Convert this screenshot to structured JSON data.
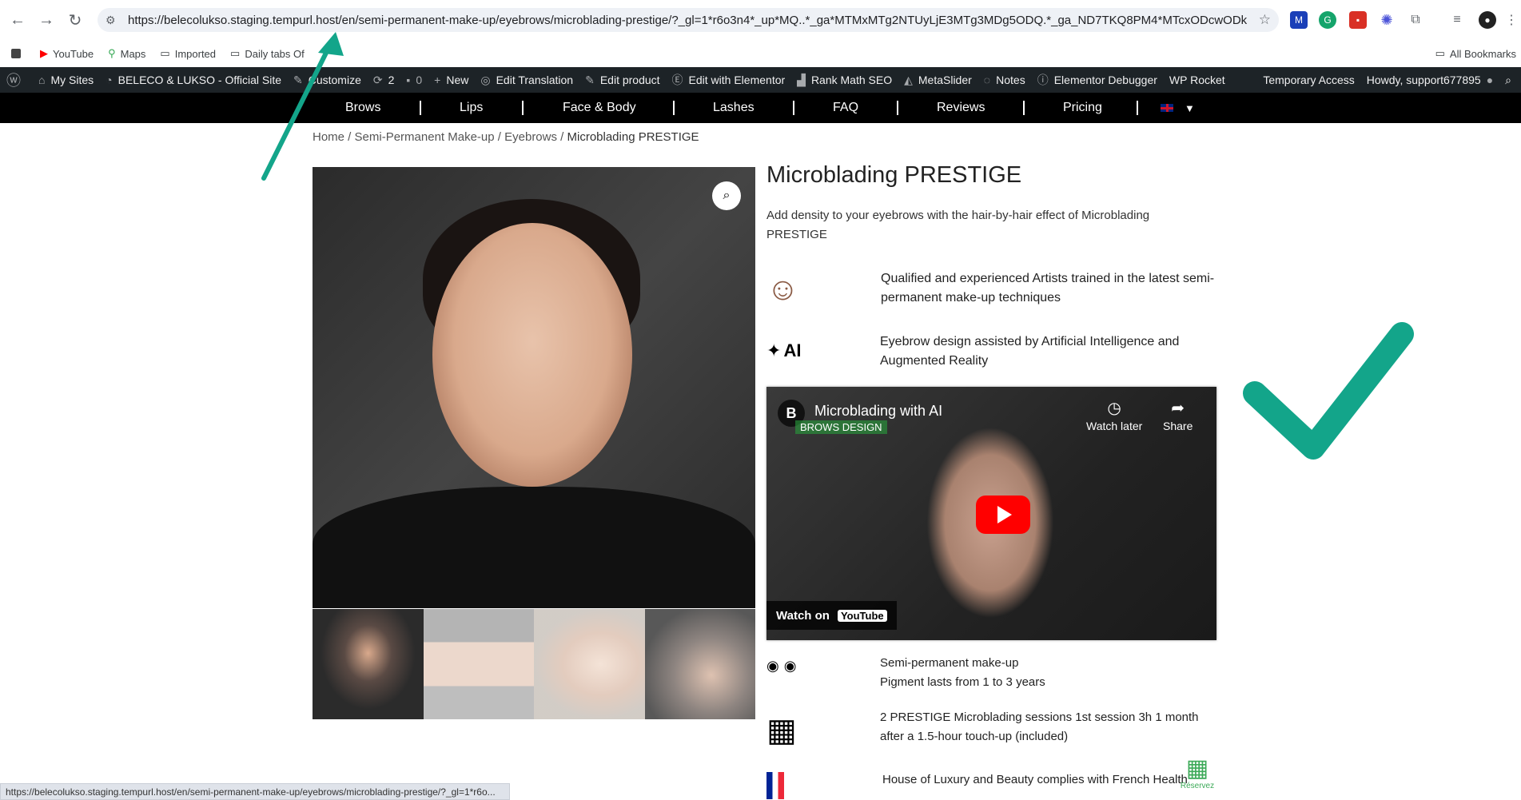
{
  "browser": {
    "url": "https://belecolukso.staging.tempurl.host/en/semi-permanent-make-up/eyebrows/microblading-prestige/?_gl=1*r6o3n4*_up*MQ..*_ga*MTMxMTg2NTUyLjE3MTg3MDg5ODQ.*_ga_ND7TKQ8PM4*MTcxODcwODk4My4xLjAuMTc...",
    "status_url": "https://belecolukso.staging.tempurl.host/en/semi-permanent-make-up/eyebrows/microblading-prestige/?_gl=1*r6o...",
    "bookmarks": [
      "YouTube",
      "Maps",
      "Imported",
      "Daily tabs Of"
    ],
    "all_bookmarks": "All Bookmarks"
  },
  "adminbar": {
    "left": [
      "My Sites",
      "BELECO & LUKSO - Official Site",
      "Customize",
      "2",
      "0",
      "New",
      "Edit Translation",
      "Edit product",
      "Edit with Elementor",
      "Rank Math SEO",
      "MetaSlider",
      "Notes",
      "Elementor Debugger",
      "WP Rocket"
    ],
    "temporary_access": "Temporary Access",
    "howdy": "Howdy, support677895"
  },
  "mainnav": [
    "Brows",
    "Lips",
    "Face & Body",
    "Lashes",
    "FAQ",
    "Reviews",
    "Pricing"
  ],
  "breadcrumb": {
    "home": "Home",
    "cat": "Semi-Permanent Make-up",
    "sub": "Eyebrows",
    "current": "Microblading PRESTIGE",
    "sep": " / "
  },
  "product": {
    "title": "Microblading PRESTIGE",
    "description": "Add density to your eyebrows with the hair-by-hair effect of Microblading PRESTIGE",
    "features": [
      {
        "text": "Qualified and experienced Artists trained in the latest semi-permanent make-up techniques"
      },
      {
        "text": "Eyebrow design assisted by Artificial Intelligence and Augmented Reality",
        "icon_label": "AI"
      },
      {
        "text": "Semi-permanent make-up",
        "text2": "Pigment lasts from 1 to 3 years"
      },
      {
        "text": "2 PRESTIGE Microblading sessions 1st session 3h   1 month after a 1.5-hour touch-up (included)"
      },
      {
        "text": "House of Luxury and Beauty complies with French",
        "tail": "Health"
      }
    ]
  },
  "video": {
    "title": "Microblading with AI",
    "subtitle": "BROWS DESIGN",
    "watch_later": "Watch later",
    "share": "Share",
    "watch_on": "Watch on",
    "youtube": "YouTube"
  },
  "reserve": "Réservez"
}
